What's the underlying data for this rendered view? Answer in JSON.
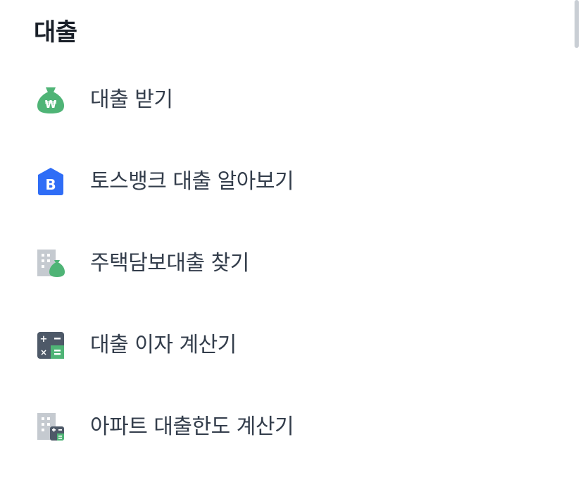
{
  "section": {
    "title": "대출"
  },
  "menu": {
    "items": [
      {
        "label": "대출 받기",
        "icon": "money-bag-won-icon"
      },
      {
        "label": "토스뱅크 대출 알아보기",
        "icon": "tossbank-b-icon"
      },
      {
        "label": "주택담보대출 찾기",
        "icon": "building-money-bag-icon"
      },
      {
        "label": "대출 이자 계산기",
        "icon": "calculator-icon"
      },
      {
        "label": "아파트 대출한도 계산기",
        "icon": "apartment-calculator-icon"
      }
    ]
  },
  "colors": {
    "green": "#4fb476",
    "blue": "#3182f6",
    "gray": "#c5cad0",
    "dark": "#4e5968"
  }
}
